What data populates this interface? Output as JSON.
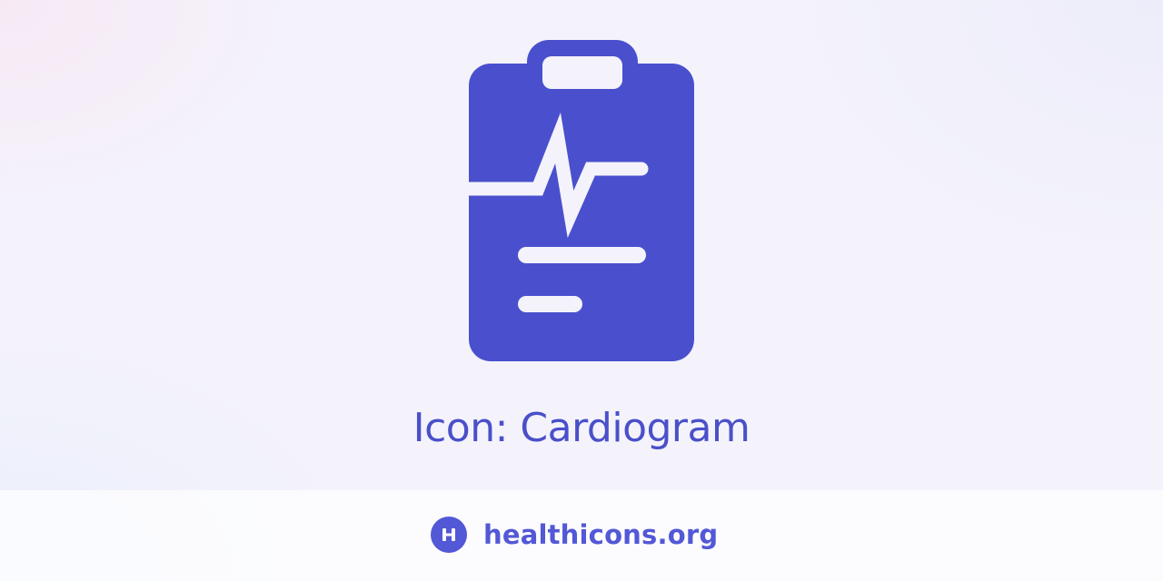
{
  "icon": {
    "name": "cardiogram-icon",
    "color": "#4a50cd"
  },
  "title": "Icon: Cardiogram",
  "footer": {
    "brand": "healthicons.org",
    "logo_icon": "healthicons-logo-icon",
    "brand_color": "#5258d6"
  }
}
